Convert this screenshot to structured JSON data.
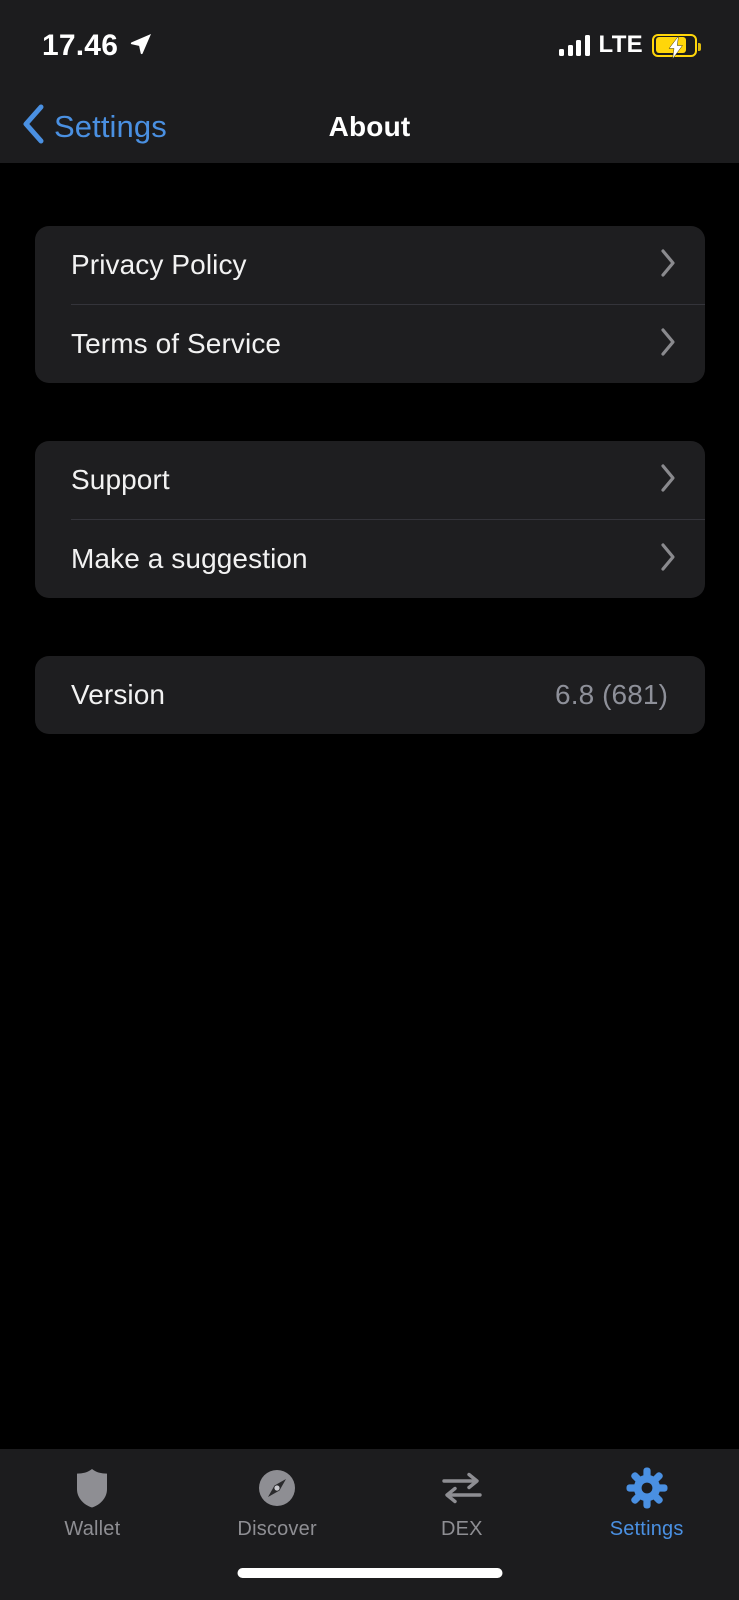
{
  "status_bar": {
    "time": "17.46",
    "location_icon": "location-arrow-icon",
    "carrier_network": "LTE",
    "signal_icon": "signal-bars-icon",
    "battery_icon": "battery-charging-icon",
    "battery_color": "#ffd60a"
  },
  "nav": {
    "back_label": "Settings",
    "back_icon": "chevron-left-icon",
    "title": "About",
    "accent_color": "#4a90e2"
  },
  "sections": [
    {
      "id": "legal",
      "rows": [
        {
          "label": "Privacy Policy",
          "accessory": "chevron-right-icon"
        },
        {
          "label": "Terms of Service",
          "accessory": "chevron-right-icon"
        }
      ]
    },
    {
      "id": "help",
      "rows": [
        {
          "label": "Support",
          "accessory": "chevron-right-icon"
        },
        {
          "label": "Make a suggestion",
          "accessory": "chevron-right-icon"
        }
      ]
    },
    {
      "id": "info",
      "rows": [
        {
          "label": "Version",
          "value": "6.8 (681)"
        }
      ]
    }
  ],
  "tab_bar": {
    "active": "Settings",
    "active_color": "#4a90e2",
    "inactive_color": "#8e8e93",
    "tabs": [
      {
        "label": "Wallet",
        "icon": "shield-icon"
      },
      {
        "label": "Discover",
        "icon": "compass-icon"
      },
      {
        "label": "DEX",
        "icon": "swap-arrows-icon"
      },
      {
        "label": "Settings",
        "icon": "gear-icon"
      }
    ]
  },
  "home_indicator": "home-indicator"
}
